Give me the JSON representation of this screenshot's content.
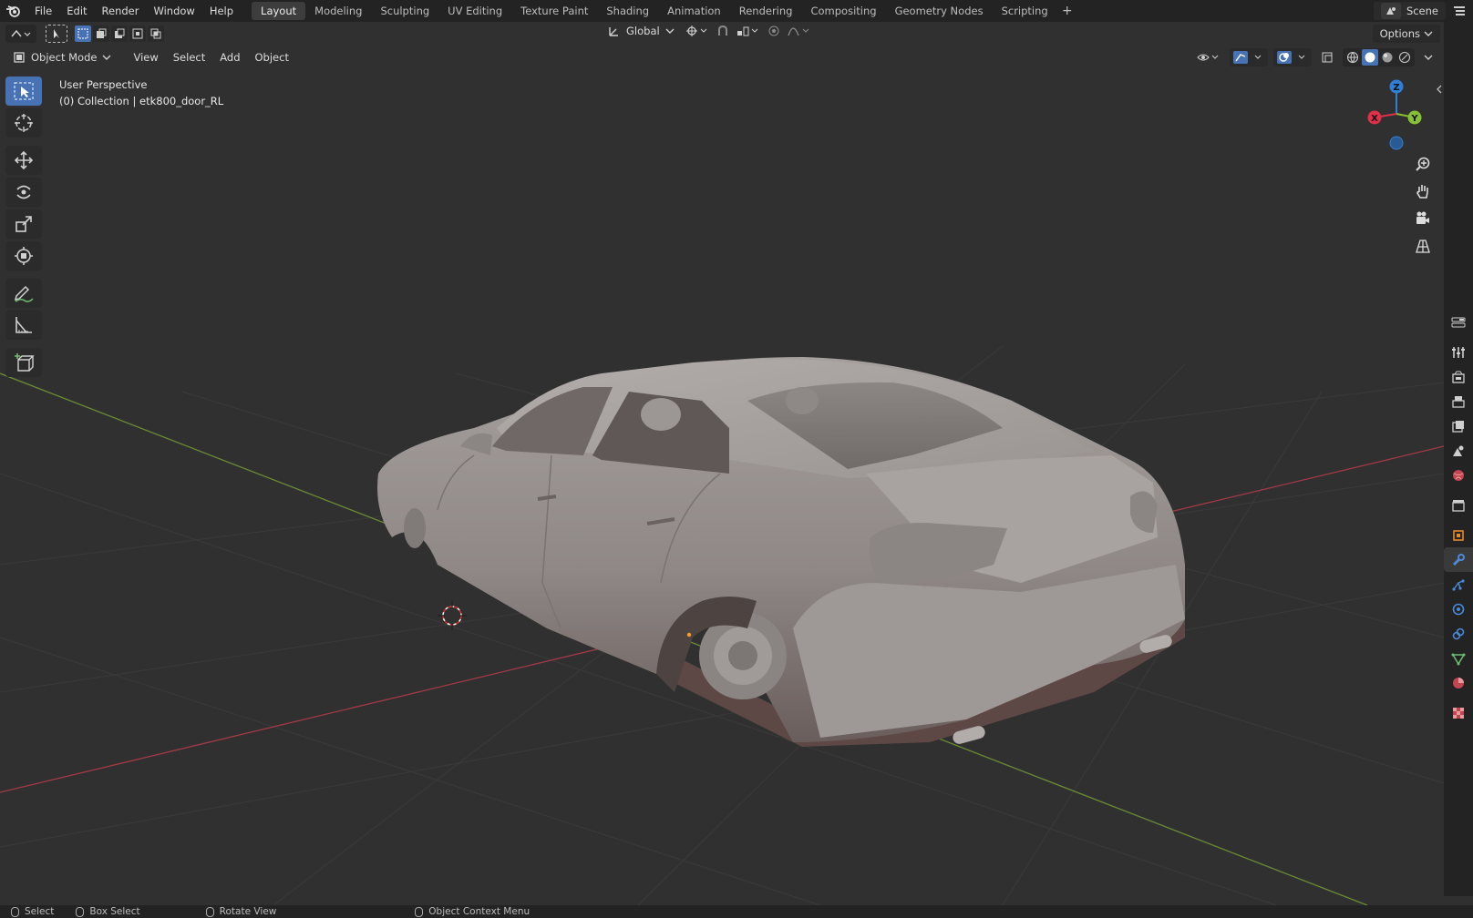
{
  "app": {
    "name": "Blender"
  },
  "menu": [
    "File",
    "Edit",
    "Render",
    "Window",
    "Help"
  ],
  "workspaces": [
    {
      "label": "Layout",
      "active": true
    },
    {
      "label": "Modeling"
    },
    {
      "label": "Sculpting"
    },
    {
      "label": "UV Editing"
    },
    {
      "label": "Texture Paint"
    },
    {
      "label": "Shading"
    },
    {
      "label": "Animation"
    },
    {
      "label": "Rendering"
    },
    {
      "label": "Compositing"
    },
    {
      "label": "Geometry Nodes"
    },
    {
      "label": "Scripting"
    }
  ],
  "scene": {
    "label": "Scene"
  },
  "tool_header": {
    "orientation": "Global",
    "options_label": "Options"
  },
  "viewport_header": {
    "mode": "Object Mode",
    "menus": [
      "View",
      "Select",
      "Add",
      "Object"
    ]
  },
  "viewport": {
    "perspective": "User Perspective",
    "collection_info": "(0) Collection | etk800_door_RL",
    "gizmo_axes": {
      "x": "X",
      "y": "Y",
      "z": "Z"
    }
  },
  "toolbar_tools": [
    {
      "icon": "select-box-icon",
      "active": true
    },
    {
      "icon": "cursor-icon"
    },
    {
      "icon": "move-icon"
    },
    {
      "icon": "rotate-icon"
    },
    {
      "icon": "scale-icon"
    },
    {
      "icon": "transform-icon"
    },
    {
      "icon": "annotate-icon"
    },
    {
      "icon": "measure-icon"
    },
    {
      "icon": "add-cube-icon"
    }
  ],
  "properties_tabs": [
    "tool-icon",
    "render-icon",
    "output-icon",
    "view-layer-icon",
    "scene-icon",
    "world-icon",
    "collection-icon",
    "object-icon",
    "modifier-icon",
    "particles-icon",
    "physics-icon",
    "constraints-icon",
    "data-icon",
    "material-icon",
    "texture-icon"
  ],
  "statusbar": [
    {
      "label": "Select"
    },
    {
      "label": "Box Select"
    },
    {
      "label": "Rotate View"
    },
    {
      "label": "Object Context Menu"
    }
  ],
  "colors": {
    "accent": "#4772b3",
    "x_axis": "#e0304a",
    "y_axis": "#88c034",
    "z_axis": "#2f7fd7",
    "viewport_bg": "#303030"
  }
}
